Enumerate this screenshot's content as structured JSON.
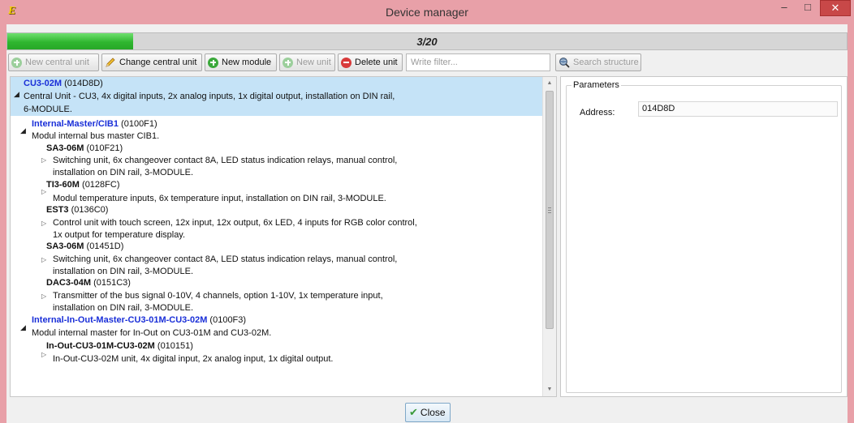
{
  "window": {
    "title": "Device manager",
    "app_icon": "E",
    "minimize": "–",
    "maximize": "□",
    "close": "✕"
  },
  "progress": {
    "text": "3/20",
    "fraction": 0.15
  },
  "toolbar": {
    "new_central_unit": "New central unit",
    "change_central_unit": "Change central unit",
    "new_module": "New module",
    "new_unit": "New unit",
    "delete_unit": "Delete unit",
    "filter_placeholder": "Write filter...",
    "search_structure": "Search structure"
  },
  "tree": {
    "root": {
      "name": "CU3-02M",
      "code": "(014D8D)",
      "desc1": "Central Unit - CU3, 4x digital inputs, 2x analog inputs, 1x digital output, installation on DIN rail,",
      "desc2": "6-MODULE."
    },
    "cib": {
      "name": "Internal-Master/CIB1",
      "code": "(0100F1)",
      "desc": "Modul internal bus master CIB1."
    },
    "sa3a": {
      "name": "SA3-06M",
      "code": "(010F21)",
      "desc1": "Switching unit, 6x changeover contact 8A, LED status indication relays, manual control,",
      "desc2": "installation on DIN rail, 3-MODULE."
    },
    "ti3": {
      "name": "TI3-60M",
      "code": "(0128FC)",
      "desc1": "Modul temperature inputs, 6x temperature input, installation on DIN rail, 3-MODULE."
    },
    "est3": {
      "name": "EST3",
      "code": "(0136C0)",
      "desc1": "Control unit with touch screen, 12x input, 12x output, 6x LED, 4 inputs for RGB color control,",
      "desc2": "1x output for temperature display."
    },
    "sa3b": {
      "name": "SA3-06M",
      "code": "(01451D)",
      "desc1": "Switching unit, 6x changeover contact 8A, LED status indication relays, manual control,",
      "desc2": "installation on DIN rail, 3-MODULE."
    },
    "dac3": {
      "name": "DAC3-04M",
      "code": "(0151C3)",
      "desc1": "Transmitter of the bus signal 0-10V, 4 channels, option 1-10V, 1x temperature input,",
      "desc2": "installation on DIN rail, 3-MODULE."
    },
    "inout": {
      "name": "Internal-In-Out-Master-CU3-01M-CU3-02M",
      "code": "(0100F3)",
      "desc": "Modul internal master for In-Out on CU3-01M and CU3-02M."
    },
    "inout_unit": {
      "name": "In-Out-CU3-01M-CU3-02M",
      "code": "(010151)",
      "desc1": "In-Out-CU3-02M unit, 4x digital input, 2x analog input, 1x digital output."
    }
  },
  "parameters": {
    "title": "Parameters",
    "address_label": "Address:",
    "address_value": "014D8D"
  },
  "footer": {
    "close": "Close"
  },
  "colors": {
    "titlebar": "#e8a0a8",
    "selection": "#c5e3f7",
    "module_name": "#1a2fd8",
    "progress_fill": "#2fb62f"
  },
  "icons": [
    "app-logo-icon",
    "plus-circle-icon",
    "pencil-icon",
    "minus-circle-icon",
    "search-globe-icon",
    "checkmark-icon",
    "expand-triangle-icon",
    "collapse-triangle-icon"
  ]
}
